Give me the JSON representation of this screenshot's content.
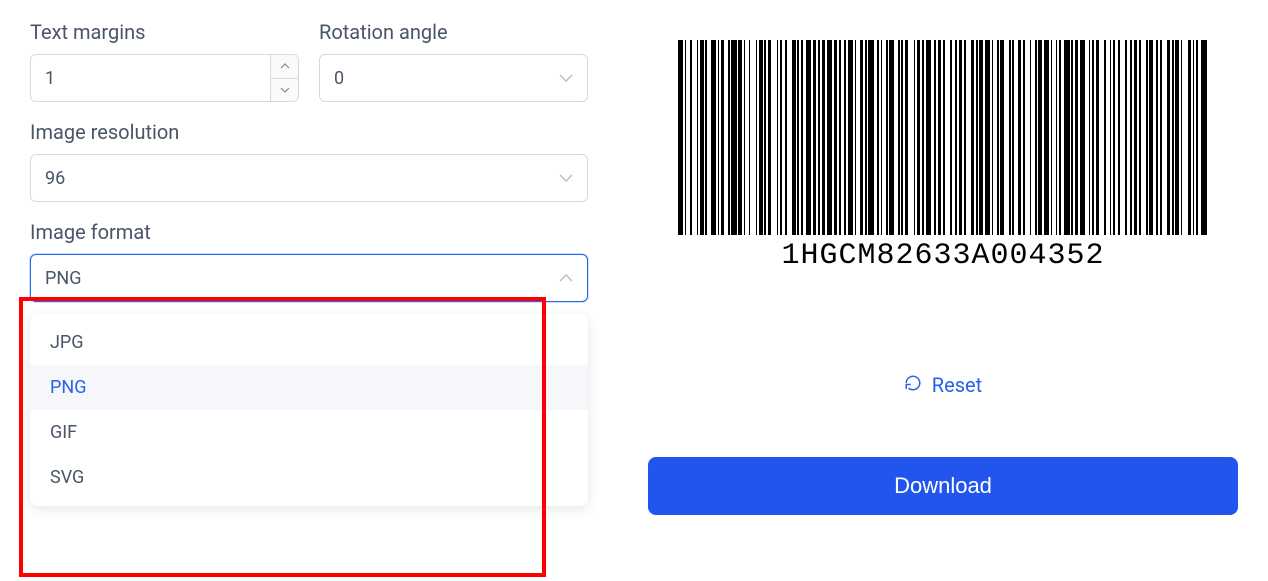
{
  "fields": {
    "text_margins": {
      "label": "Text margins",
      "value": "1"
    },
    "rotation_angle": {
      "label": "Rotation angle",
      "value": "0"
    },
    "image_resolution": {
      "label": "Image resolution",
      "value": "96"
    },
    "image_format": {
      "label": "Image format",
      "value": "PNG",
      "options": [
        "JPG",
        "PNG",
        "GIF",
        "SVG"
      ],
      "selected_index": 1
    }
  },
  "barcode": {
    "text": "1HGCM82633A004352"
  },
  "actions": {
    "reset": "Reset",
    "download": "Download"
  }
}
